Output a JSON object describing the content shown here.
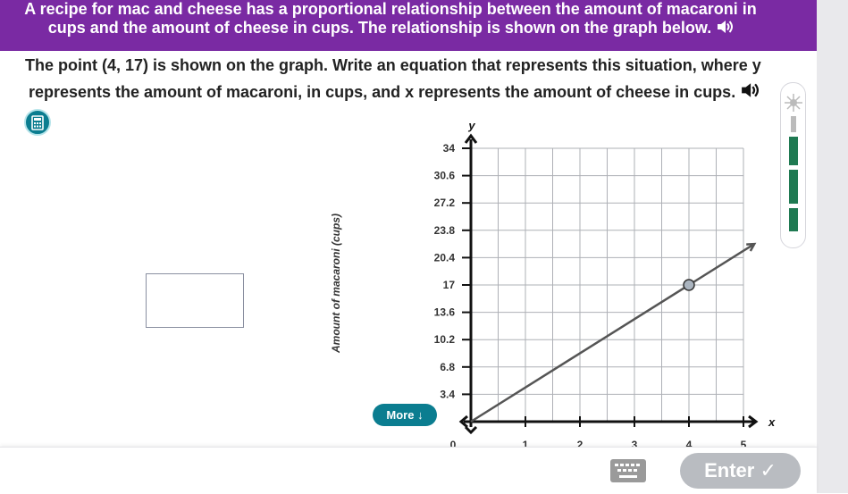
{
  "header": {
    "line1": "A recipe for mac and cheese has a proportional relationship between the amount of macaroni in",
    "line2": "cups and the amount of cheese in cups. The relationship is shown on the graph below.",
    "speaker_icon": "speaker-icon"
  },
  "prompt": {
    "line1": "The point (4, 17) is shown on the graph. Write an equation that represents this situation, where y",
    "line2": "represents the amount of macaroni, in cups, and x represents the amount of cheese in cups.",
    "speaker_icon": "speaker-icon"
  },
  "calculator": {
    "icon": "calculator-icon"
  },
  "answer": {
    "value": ""
  },
  "more_button": {
    "label": "More"
  },
  "enter_button": {
    "label": "Enter ✓"
  },
  "keyboard": {
    "icon": "keyboard-icon"
  },
  "colors": {
    "header_bg": "#7a2aa3",
    "accent": "#0b7d90",
    "tool_green": "#1f7a52"
  },
  "chart_data": {
    "type": "line",
    "xlabel": "x",
    "ylabel": "y",
    "y_axis_title": "Amount of macaroni (cups)",
    "xlim": [
      0,
      5
    ],
    "ylim": [
      0,
      34
    ],
    "x_ticks": [
      "0",
      "1",
      "2",
      "3",
      "4",
      "5"
    ],
    "y_ticks": [
      "3.4",
      "6.8",
      "10.2",
      "13.6",
      "17",
      "20.4",
      "23.8",
      "27.2",
      "30.6",
      "34"
    ],
    "series": [
      {
        "x": [
          0,
          4,
          5.2
        ],
        "y": [
          0,
          17,
          22.1
        ]
      }
    ],
    "points": [
      {
        "x": 4,
        "y": 17
      }
    ],
    "grid": true
  }
}
